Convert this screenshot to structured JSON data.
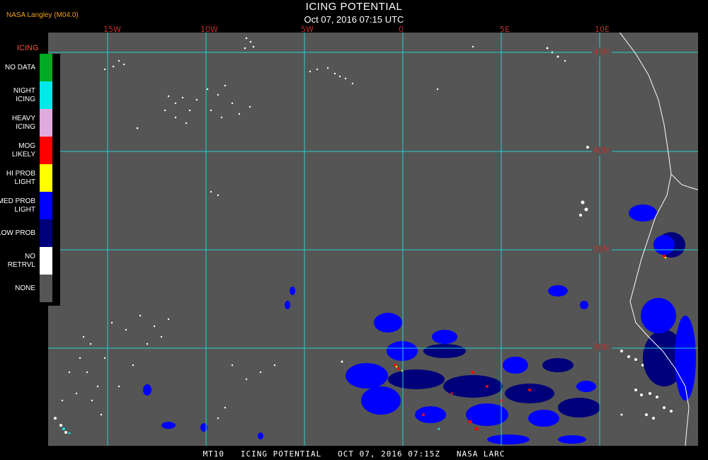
{
  "header": {
    "title": "ICING POTENTIAL",
    "timestamp": "Oct 07, 2016 07:15 UTC",
    "source": "NASA Langley (M04.0)"
  },
  "map": {
    "longitude_labels": [
      "15W",
      "10W",
      "5W",
      "0",
      "5E",
      "10E"
    ],
    "latitude_labels": [
      "45N",
      "40N",
      "35N",
      "30N"
    ],
    "background_color": "#555555",
    "grid_color": "#22d3d3",
    "coastline_color": "#ffffff"
  },
  "legend": {
    "title": "ICING",
    "items": [
      {
        "label": "NO DATA",
        "color": "#00aa22"
      },
      {
        "label": "NIGHT ICING",
        "color": "#00e8e8"
      },
      {
        "label": "HEAVY ICING",
        "color": "#e0aadd"
      },
      {
        "label": "MOG LIKELY",
        "color": "#ff0000"
      },
      {
        "label": "HI PROB LIGHT",
        "color": "#ffff00"
      },
      {
        "label": "MED PROB LIGHT",
        "color": "#0000ff"
      },
      {
        "label": "LOW PROB",
        "color": "#00007a"
      },
      {
        "label": "NO RETRVL",
        "color": "#ffffff"
      },
      {
        "label": "NONE",
        "color": "#555555"
      }
    ]
  },
  "footer": {
    "text": "MT10   ICING POTENTIAL   OCT 07, 2016 07:15Z   NASA LARC"
  }
}
